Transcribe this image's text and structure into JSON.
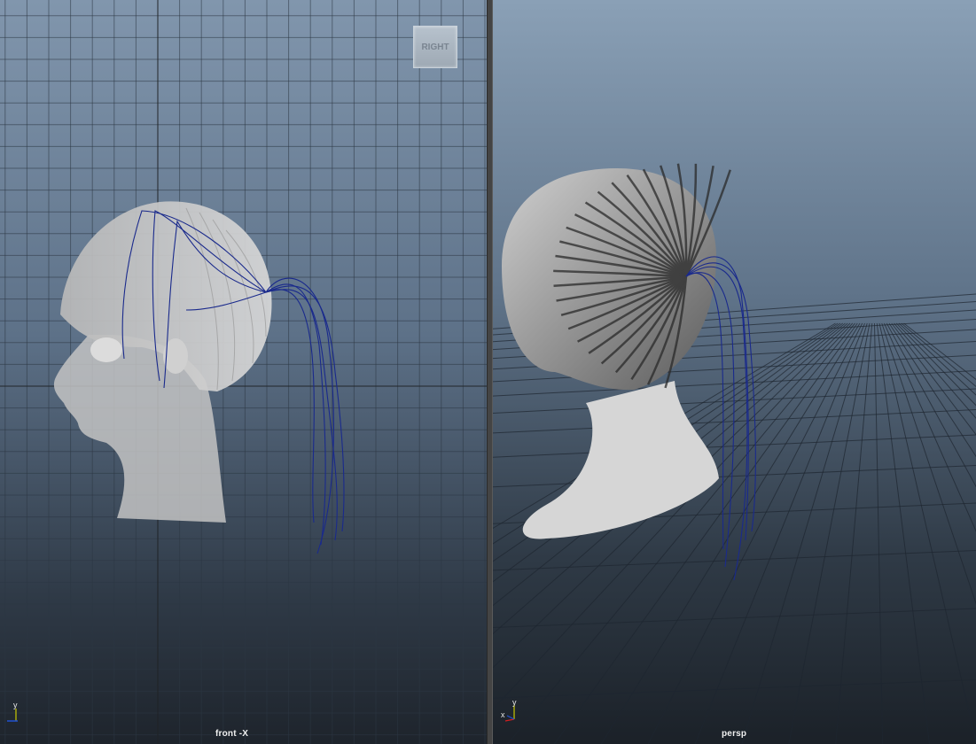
{
  "viewports": {
    "left": {
      "camera_label": "front -X",
      "view_cube_label": "RIGHT"
    },
    "right": {
      "camera_label": "persp"
    }
  },
  "gizmo": {
    "x": "x",
    "y": "y"
  },
  "colors": {
    "grid_line": "#2c3743",
    "grid_axis": "#1c1c1c",
    "mesh": "#c9c9c9",
    "curve": "#1a2a8c",
    "gizmo_x": "#d02020",
    "gizmo_y": "#c8c800",
    "gizmo_z": "#2050d0"
  }
}
